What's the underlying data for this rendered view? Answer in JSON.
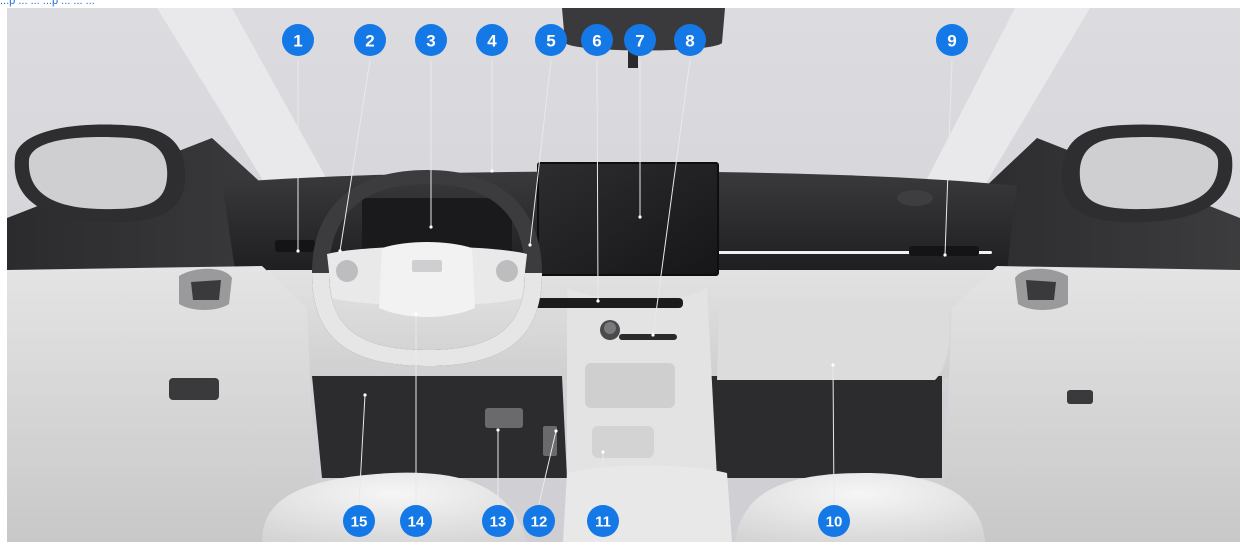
{
  "caption": "...p ... ... ...p ... ... ...",
  "markers": [
    {
      "label": "1",
      "name": "marker-1"
    },
    {
      "label": "2",
      "name": "marker-2"
    },
    {
      "label": "3",
      "name": "marker-3"
    },
    {
      "label": "4",
      "name": "marker-4"
    },
    {
      "label": "5",
      "name": "marker-5"
    },
    {
      "label": "6",
      "name": "marker-6"
    },
    {
      "label": "7",
      "name": "marker-7"
    },
    {
      "label": "8",
      "name": "marker-8"
    },
    {
      "label": "9",
      "name": "marker-9"
    },
    {
      "label": "10",
      "name": "marker-10"
    },
    {
      "label": "11",
      "name": "marker-11"
    },
    {
      "label": "12",
      "name": "marker-12"
    },
    {
      "label": "13",
      "name": "marker-13"
    },
    {
      "label": "14",
      "name": "marker-14"
    },
    {
      "label": "15",
      "name": "marker-15"
    }
  ],
  "colors": {
    "marker": "#1478e6",
    "marker_text": "#ffffff",
    "cabin_background": "#d6d6da",
    "dashboard": "#2a2a2c",
    "seat": "#ececec"
  }
}
